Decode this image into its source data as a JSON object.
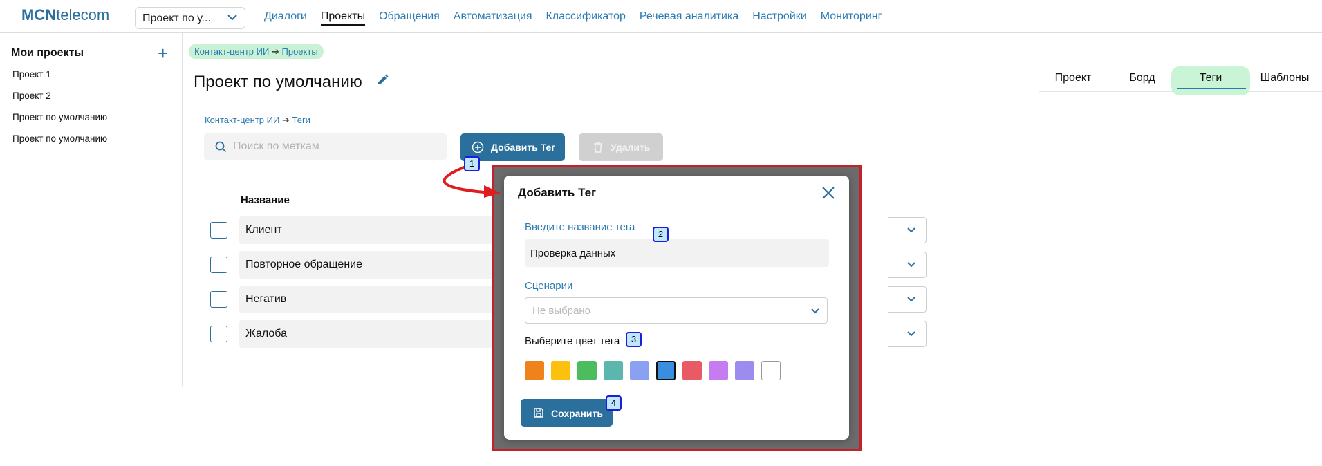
{
  "header": {
    "logo_bold": "MCN",
    "logo_rest": "telecom",
    "project_select": "Проект по у...",
    "nav": [
      "Диалоги",
      "Проекты",
      "Обращения",
      "Автоматизация",
      "Классификатор",
      "Речевая аналитика",
      "Настройки",
      "Мониторинг"
    ],
    "active_nav": "Проекты"
  },
  "sidebar": {
    "title": "Мои проекты",
    "items": [
      "Проект 1",
      "Проект 2",
      "Проект по умолчанию",
      "Проект по умолчанию"
    ]
  },
  "breadcrumb": {
    "parent": "Контакт-центр ИИ",
    "arrow": "➔",
    "current": "Проекты"
  },
  "page": {
    "title": "Проект по умолчанию"
  },
  "tabs": [
    "Проект",
    "Борд",
    "Теги",
    "Шаблоны"
  ],
  "active_tab": "Теги",
  "tags_view": {
    "breadcrumb": {
      "parent": "Контакт-центр ИИ",
      "arrow": "➔",
      "current": "Теги"
    },
    "search_placeholder": "Поиск по меткам",
    "add_label": "Добавить Тег",
    "delete_label": "Удалить",
    "column_name": "Название",
    "rows": [
      "Клиент",
      "Повторное обращение",
      "Негатив",
      "Жалоба"
    ]
  },
  "modal": {
    "title": "Добавить Тег",
    "name_label": "Введите название тега",
    "name_value": "Проверка данных",
    "scenarios_label": "Сценарии",
    "scenarios_value": "Не выбрано",
    "color_label": "Выберите цвет тега",
    "colors": [
      "#f0821e",
      "#fcc10f",
      "#4bbd5e",
      "#5bb7ad",
      "#8aa0f0",
      "#3a8ee0",
      "#e85a64",
      "#c67cf0",
      "#9c8cf0",
      "#ffffff"
    ],
    "selected_color": "#3a8ee0",
    "save_label": "Сохранить"
  },
  "markers": [
    "1",
    "2",
    "3",
    "4"
  ],
  "accent_color": "#2b6f9c"
}
